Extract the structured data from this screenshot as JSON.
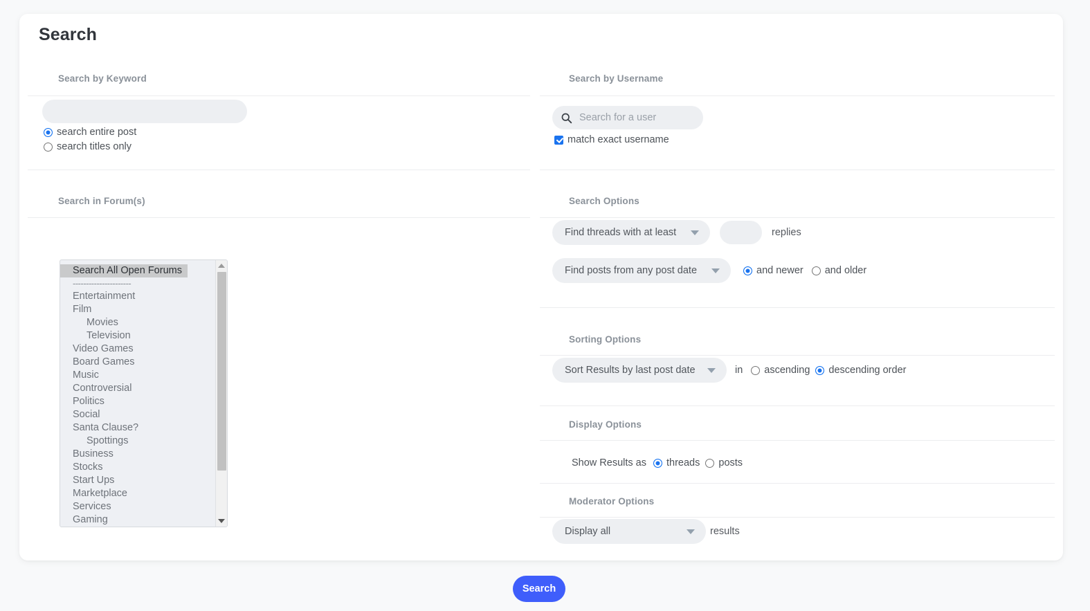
{
  "page": {
    "title": "Search",
    "submit_label": "Search"
  },
  "colors": {
    "accent": "#3f5efb",
    "control_blue": "#1a73ef",
    "field_bg": "#edeff2",
    "page_bg": "#f8f9fa",
    "card_bg": "#ffffff",
    "heading": "#8a9199"
  },
  "keyword": {
    "heading": "Search by Keyword",
    "input_value": "",
    "input_placeholder": "",
    "scope_options": [
      {
        "label": "search entire post",
        "checked": true
      },
      {
        "label": "search titles only",
        "checked": false
      }
    ]
  },
  "username": {
    "heading": "Search by Username",
    "icon": "search-icon",
    "input_value": "",
    "input_placeholder": "Search for a user",
    "exact_label": "match exact username",
    "exact_checked": true
  },
  "forums": {
    "heading": "Search in Forum(s)",
    "items": [
      {
        "label": "Search All Open Forums",
        "indent": 0,
        "selected": true,
        "separator": false
      },
      {
        "label": "----------------------",
        "indent": 0,
        "selected": false,
        "separator": true
      },
      {
        "label": "Entertainment",
        "indent": 0,
        "selected": false,
        "separator": false
      },
      {
        "label": "Film",
        "indent": 1,
        "selected": false,
        "separator": false
      },
      {
        "label": "Movies",
        "indent": 2,
        "selected": false,
        "separator": false
      },
      {
        "label": "Television",
        "indent": 2,
        "selected": false,
        "separator": false
      },
      {
        "label": "Video Games",
        "indent": 1,
        "selected": false,
        "separator": false
      },
      {
        "label": "Board Games",
        "indent": 1,
        "selected": false,
        "separator": false
      },
      {
        "label": "Music",
        "indent": 1,
        "selected": false,
        "separator": false
      },
      {
        "label": "Controversial",
        "indent": 0,
        "selected": false,
        "separator": false
      },
      {
        "label": "Politics",
        "indent": 1,
        "selected": false,
        "separator": false
      },
      {
        "label": "Social",
        "indent": 1,
        "selected": false,
        "separator": false
      },
      {
        "label": "Santa Clause?",
        "indent": 1,
        "selected": false,
        "separator": false
      },
      {
        "label": "Spottings",
        "indent": 2,
        "selected": false,
        "separator": false
      },
      {
        "label": "Business",
        "indent": 0,
        "selected": false,
        "separator": false
      },
      {
        "label": "Stocks",
        "indent": 1,
        "selected": false,
        "separator": false
      },
      {
        "label": "Start Ups",
        "indent": 1,
        "selected": false,
        "separator": false
      },
      {
        "label": "Marketplace",
        "indent": 1,
        "selected": false,
        "separator": false
      },
      {
        "label": "Services",
        "indent": 1,
        "selected": false,
        "separator": false
      },
      {
        "label": "Gaming",
        "indent": 0,
        "selected": false,
        "separator": false
      }
    ]
  },
  "search_options": {
    "heading": "Search Options",
    "replies_select": "Find threads with at least",
    "replies_value": "",
    "replies_suffix": "replies",
    "date_select": "Find posts from any post date",
    "date_direction": [
      {
        "label": "and newer",
        "checked": true
      },
      {
        "label": "and older",
        "checked": false
      }
    ]
  },
  "sorting_options": {
    "heading": "Sorting Options",
    "sort_select": "Sort Results by last post date",
    "in_label": "in",
    "order": [
      {
        "label": "ascending",
        "checked": false
      },
      {
        "label": "descending order",
        "checked": true
      }
    ]
  },
  "display_options": {
    "heading": "Display Options",
    "show_as_label": "Show Results as",
    "show_as": [
      {
        "label": "threads",
        "checked": true
      },
      {
        "label": "posts",
        "checked": false
      }
    ]
  },
  "moderator_options": {
    "heading": "Moderator Options",
    "display_select": "Display all",
    "display_suffix": "results"
  }
}
